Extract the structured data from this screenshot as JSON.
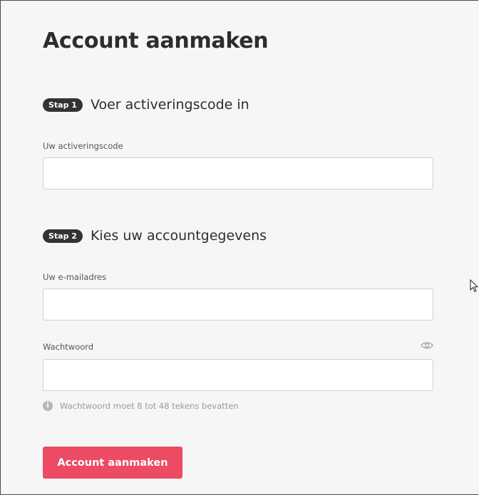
{
  "page": {
    "title": "Account aanmaken"
  },
  "step1": {
    "badge": "Stap 1",
    "heading": "Voer activeringscode in",
    "code_label": "Uw activeringscode",
    "code_value": ""
  },
  "step2": {
    "badge": "Stap 2",
    "heading": "Kies uw accountgegevens",
    "email_label": "Uw e-mailadres",
    "email_value": "",
    "password_label": "Wachtwoord",
    "password_value": "",
    "password_toggle_icon": "eye-icon",
    "hint_icon": "info-icon",
    "hint_text": "Wachtwoord moet 8 tot 48 tekens bevatten"
  },
  "submit": {
    "label": "Account aanmaken"
  },
  "colors": {
    "accent": "#ec4b63",
    "badge": "#333333",
    "background": "#f6f6f6"
  }
}
